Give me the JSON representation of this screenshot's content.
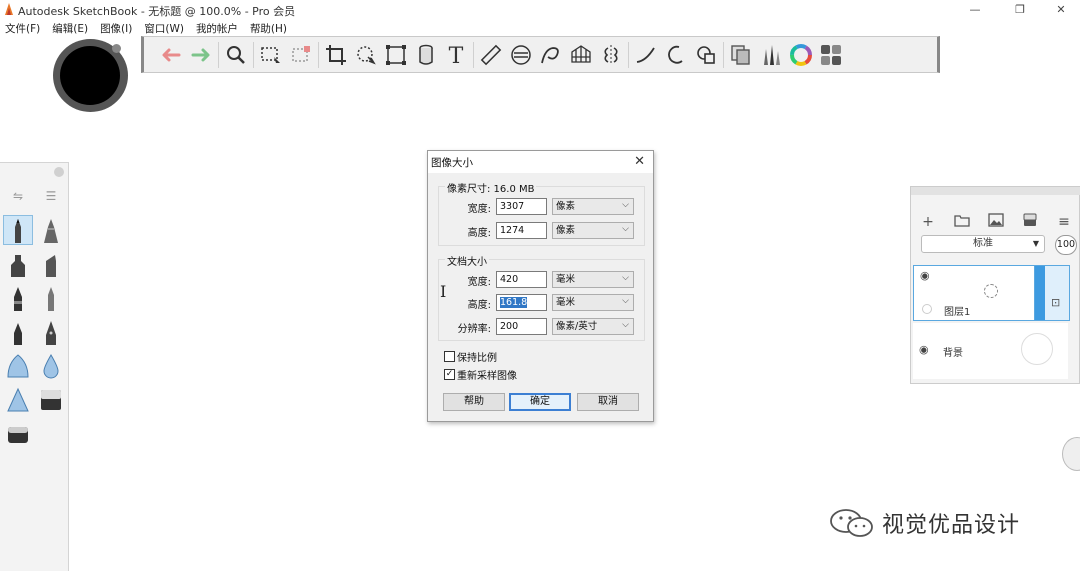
{
  "window": {
    "title": "Autodesk SketchBook - 无标题 @ 100.0% - Pro 会员",
    "controls": [
      "minimize",
      "restore",
      "close"
    ]
  },
  "menu": [
    "文件(F)",
    "编辑(E)",
    "图像(I)",
    "窗口(W)",
    "我的帐户",
    "帮助(H)"
  ],
  "toolbar": {
    "icons": [
      "undo-icon",
      "redo-icon",
      "zoom-icon",
      "select-icon",
      "transform-select-icon",
      "crop-icon",
      "lasso-icon",
      "distort-icon",
      "perspective-icon",
      "text-icon",
      "ruler-icon",
      "ellipse-guide-icon",
      "curve-icon",
      "perspective-grid-icon",
      "symmetry-icon",
      "stroke-icon",
      "circle-icon",
      "shape-icon",
      "copy-icon",
      "brush-library-icon",
      "color-wheel-icon",
      "color-swatches-icon"
    ],
    "colors": {
      "undo": "#e88a8a",
      "redo": "#7cc48a"
    }
  },
  "dialog": {
    "title": "图像大小",
    "pixel_group": {
      "title": "像素尺寸: 16.0 MB",
      "width_label": "宽度:",
      "width_value": "3307",
      "width_unit": "像素",
      "height_label": "高度:",
      "height_value": "1274",
      "height_unit": "像素"
    },
    "doc_group": {
      "title": "文档大小",
      "width_label": "宽度:",
      "width_value": "420",
      "width_unit": "毫米",
      "height_label": "高度:",
      "height_value": "161.8",
      "height_unit": "毫米",
      "res_label": "分辨率:",
      "res_value": "200",
      "res_unit": "像素/英寸"
    },
    "keep_ratio": {
      "label": "保持比例",
      "checked": false
    },
    "resample": {
      "label": "重新采样图像",
      "checked": true,
      "mark": "✓"
    },
    "buttons": {
      "help": "帮助",
      "ok": "确定",
      "cancel": "取消"
    }
  },
  "layers": {
    "blend_mode": "标准",
    "opacity": "100",
    "items": [
      {
        "name": "图层1",
        "selected": true
      },
      {
        "name": "背景",
        "selected": false
      }
    ]
  },
  "watermark": "视觉优品设计"
}
